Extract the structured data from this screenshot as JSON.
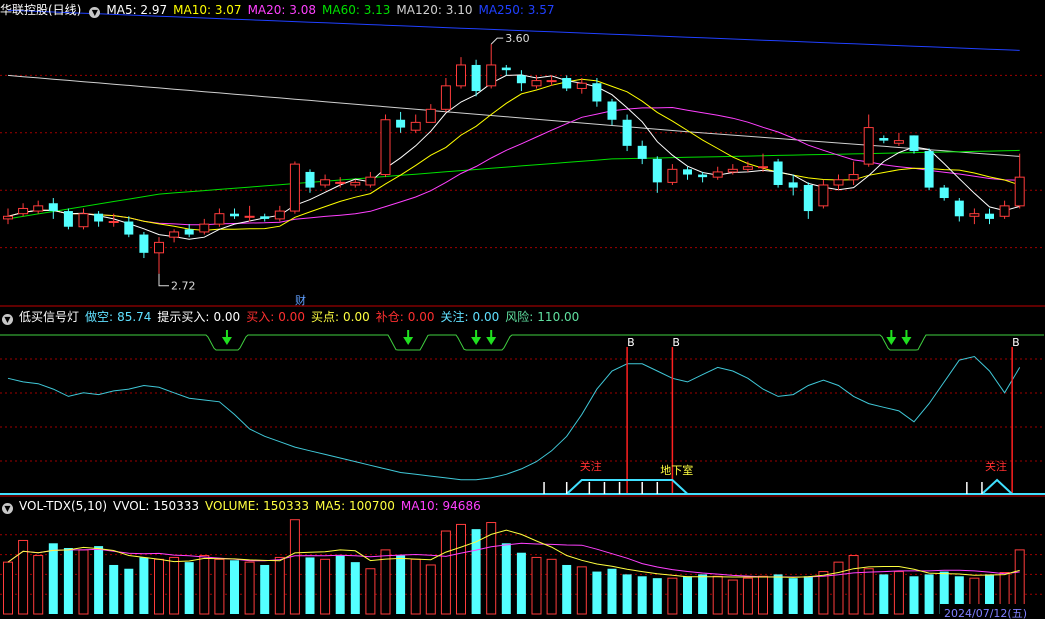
{
  "panel1": {
    "title": "华联控股(日线)",
    "ma": [
      {
        "label": "MA5: 2.97",
        "color": "#ffffff"
      },
      {
        "label": "MA10: 3.07",
        "color": "#ffff00"
      },
      {
        "label": "MA20: 3.08",
        "color": "#ff40ff"
      },
      {
        "label": "MA60: 3.13",
        "color": "#00e000"
      },
      {
        "label": "MA120: 3.10",
        "color": "#d0d0d0"
      },
      {
        "label": "MA250: 3.57",
        "color": "#2040ff"
      }
    ],
    "high_label": "3.60",
    "low_label": "2.72",
    "cai_label": "财"
  },
  "panel2": {
    "title": "低买信号灯",
    "items": [
      {
        "name": "做空:",
        "value": "85.74",
        "ncolor": "#60e0ff",
        "vcolor": "#60e0ff"
      },
      {
        "name": "提示买入:",
        "value": "0.00",
        "ncolor": "#ffffff",
        "vcolor": "#ffffff"
      },
      {
        "name": "买入:",
        "value": "0.00",
        "ncolor": "#ff3030",
        "vcolor": "#ff3030"
      },
      {
        "name": "买点:",
        "value": "0.00",
        "ncolor": "#ffff40",
        "vcolor": "#ffff40"
      },
      {
        "name": "补仓:",
        "value": "0.00",
        "ncolor": "#ff3030",
        "vcolor": "#ff3030"
      },
      {
        "name": "关注:",
        "value": "0.00",
        "ncolor": "#60e0ff",
        "vcolor": "#60e0ff"
      },
      {
        "name": "风险:",
        "value": "110.00",
        "ncolor": "#60e0a0",
        "vcolor": "#60e0a0"
      }
    ],
    "b_label": "B",
    "guanzhu": "关注",
    "dixiashi": "地下室"
  },
  "panel3": {
    "title": "VOL-TDX(5,10)",
    "items": [
      {
        "label": "VVOL: 150333",
        "color": "#ffffff"
      },
      {
        "label": "VOLUME: 150333",
        "color": "#ffff40"
      },
      {
        "label": "MA5: 100700",
        "color": "#ffff40"
      },
      {
        "label": "MA10: 94686",
        "color": "#ff40ff"
      }
    ],
    "date_label": "2024/07/12(五)"
  },
  "colors": {
    "up": "#ff3c3c",
    "down": "#54ffff",
    "grid": "#a00000",
    "panel_border": "#c00000"
  },
  "chart_data": {
    "type": "candlestick",
    "title": "华联控股(日线)",
    "ylim": [
      2.6,
      3.7
    ],
    "high": 3.6,
    "low": 2.72,
    "candles": [
      [
        2.93,
        2.94,
        2.97,
        2.91
      ],
      [
        2.95,
        2.97,
        2.99,
        2.94
      ],
      [
        2.96,
        2.98,
        3.0,
        2.95
      ],
      [
        2.99,
        2.96,
        3.01,
        2.93
      ],
      [
        2.96,
        2.9,
        2.97,
        2.89
      ],
      [
        2.9,
        2.95,
        2.97,
        2.89
      ],
      [
        2.95,
        2.92,
        2.96,
        2.9
      ],
      [
        2.92,
        2.92,
        2.95,
        2.9
      ],
      [
        2.92,
        2.87,
        2.94,
        2.86
      ],
      [
        2.87,
        2.8,
        2.88,
        2.78
      ],
      [
        2.8,
        2.84,
        2.86,
        2.72
      ],
      [
        2.86,
        2.88,
        2.89,
        2.84
      ],
      [
        2.89,
        2.87,
        2.91,
        2.86
      ],
      [
        2.88,
        2.91,
        2.93,
        2.87
      ],
      [
        2.91,
        2.95,
        2.97,
        2.9
      ],
      [
        2.95,
        2.94,
        2.97,
        2.93
      ],
      [
        2.94,
        2.94,
        2.98,
        2.92
      ],
      [
        2.94,
        2.93,
        2.95,
        2.92
      ],
      [
        2.93,
        2.96,
        2.98,
        2.92
      ],
      [
        2.96,
        3.14,
        3.15,
        2.95
      ],
      [
        3.11,
        3.05,
        3.12,
        3.03
      ],
      [
        3.06,
        3.08,
        3.1,
        3.05
      ],
      [
        3.07,
        3.07,
        3.09,
        3.05
      ],
      [
        3.06,
        3.07,
        3.08,
        3.05
      ],
      [
        3.06,
        3.09,
        3.11,
        3.05
      ],
      [
        3.1,
        3.31,
        3.33,
        3.09
      ],
      [
        3.31,
        3.28,
        3.34,
        3.26
      ],
      [
        3.27,
        3.3,
        3.33,
        3.26
      ],
      [
        3.3,
        3.35,
        3.37,
        3.3
      ],
      [
        3.35,
        3.44,
        3.47,
        3.34
      ],
      [
        3.44,
        3.52,
        3.55,
        3.43
      ],
      [
        3.52,
        3.42,
        3.54,
        3.4
      ],
      [
        3.44,
        3.52,
        3.6,
        3.43
      ],
      [
        3.51,
        3.5,
        3.52,
        3.48
      ],
      [
        3.48,
        3.45,
        3.5,
        3.42
      ],
      [
        3.44,
        3.46,
        3.48,
        3.43
      ],
      [
        3.46,
        3.46,
        3.48,
        3.44
      ],
      [
        3.47,
        3.43,
        3.48,
        3.42
      ],
      [
        3.43,
        3.45,
        3.47,
        3.41
      ],
      [
        3.45,
        3.38,
        3.47,
        3.36
      ],
      [
        3.38,
        3.31,
        3.39,
        3.29
      ],
      [
        3.31,
        3.21,
        3.33,
        3.19
      ],
      [
        3.21,
        3.16,
        3.23,
        3.14
      ],
      [
        3.16,
        3.07,
        3.17,
        3.03
      ],
      [
        3.07,
        3.12,
        3.14,
        3.06
      ],
      [
        3.12,
        3.1,
        3.13,
        3.08
      ],
      [
        3.1,
        3.09,
        3.11,
        3.07
      ],
      [
        3.09,
        3.11,
        3.13,
        3.08
      ],
      [
        3.11,
        3.12,
        3.14,
        3.1
      ],
      [
        3.12,
        3.13,
        3.15,
        3.11
      ],
      [
        3.13,
        3.13,
        3.18,
        3.11
      ],
      [
        3.15,
        3.06,
        3.16,
        3.05
      ],
      [
        3.07,
        3.05,
        3.1,
        3.02
      ],
      [
        3.06,
        2.96,
        3.07,
        2.93
      ],
      [
        2.98,
        3.06,
        3.08,
        2.97
      ],
      [
        3.06,
        3.08,
        3.1,
        3.04
      ],
      [
        3.08,
        3.1,
        3.15,
        3.06
      ],
      [
        3.14,
        3.28,
        3.33,
        3.13
      ],
      [
        3.24,
        3.23,
        3.25,
        3.22
      ],
      [
        3.22,
        3.23,
        3.26,
        3.21
      ],
      [
        3.25,
        3.19,
        3.25,
        3.18
      ],
      [
        3.19,
        3.05,
        3.2,
        3.04
      ],
      [
        3.05,
        3.01,
        3.06,
        3.0
      ],
      [
        3.0,
        2.94,
        3.01,
        2.92
      ],
      [
        2.94,
        2.95,
        2.97,
        2.91
      ],
      [
        2.95,
        2.93,
        2.97,
        2.91
      ],
      [
        2.94,
        2.98,
        3.0,
        2.93
      ],
      [
        2.98,
        3.09,
        3.18,
        2.97
      ]
    ],
    "ma_lines": [
      "MA5",
      "MA10",
      "MA20",
      "MA60",
      "MA120",
      "MA250"
    ],
    "volume": [
      55,
      78,
      62,
      75,
      70,
      68,
      72,
      52,
      48,
      60,
      58,
      60,
      55,
      62,
      58,
      57,
      55,
      52,
      60,
      100,
      60,
      58,
      62,
      55,
      48,
      68,
      62,
      58,
      52,
      88,
      95,
      90,
      97,
      75,
      65,
      60,
      58,
      52,
      50,
      45,
      48,
      42,
      40,
      38,
      38,
      40,
      42,
      40,
      36,
      38,
      40,
      42,
      38,
      40,
      45,
      55,
      62,
      48,
      42,
      45,
      40,
      42,
      45,
      40,
      38,
      42,
      44,
      68
    ],
    "volume_up": [
      true,
      true,
      true,
      false,
      false,
      true,
      false,
      false,
      false,
      false,
      true,
      true,
      false,
      true,
      true,
      false,
      true,
      false,
      true,
      true,
      false,
      true,
      false,
      false,
      true,
      true,
      false,
      true,
      true,
      true,
      true,
      false,
      true,
      false,
      false,
      true,
      true,
      false,
      true,
      false,
      false,
      false,
      false,
      false,
      true,
      false,
      false,
      true,
      true,
      true,
      true,
      false,
      false,
      false,
      true,
      true,
      true,
      true,
      false,
      true,
      false,
      false,
      false,
      false,
      true,
      false,
      true,
      true
    ],
    "indicator": {
      "name": "做空",
      "values": [
        3.0,
        2.9,
        2.85,
        2.7,
        2.5,
        2.6,
        2.55,
        2.65,
        2.7,
        2.8,
        2.75,
        2.6,
        2.45,
        2.4,
        2.35,
        2.0,
        1.6,
        1.4,
        1.25,
        1.1,
        1.0,
        0.9,
        0.8,
        0.7,
        0.6,
        0.5,
        0.4,
        0.35,
        0.3,
        0.25,
        0.2,
        0.2,
        0.25,
        0.35,
        0.5,
        0.7,
        1.0,
        1.4,
        2.0,
        2.7,
        3.2,
        3.4,
        3.4,
        3.2,
        3.0,
        2.9,
        3.1,
        3.3,
        3.2,
        3.0,
        2.7,
        2.5,
        2.55,
        2.8,
        2.95,
        2.8,
        2.5,
        2.3,
        2.2,
        2.1,
        1.8,
        2.3,
        2.9,
        3.5,
        3.6,
        3.2,
        2.6,
        3.3
      ],
      "ylim": [
        0,
        4
      ]
    }
  }
}
